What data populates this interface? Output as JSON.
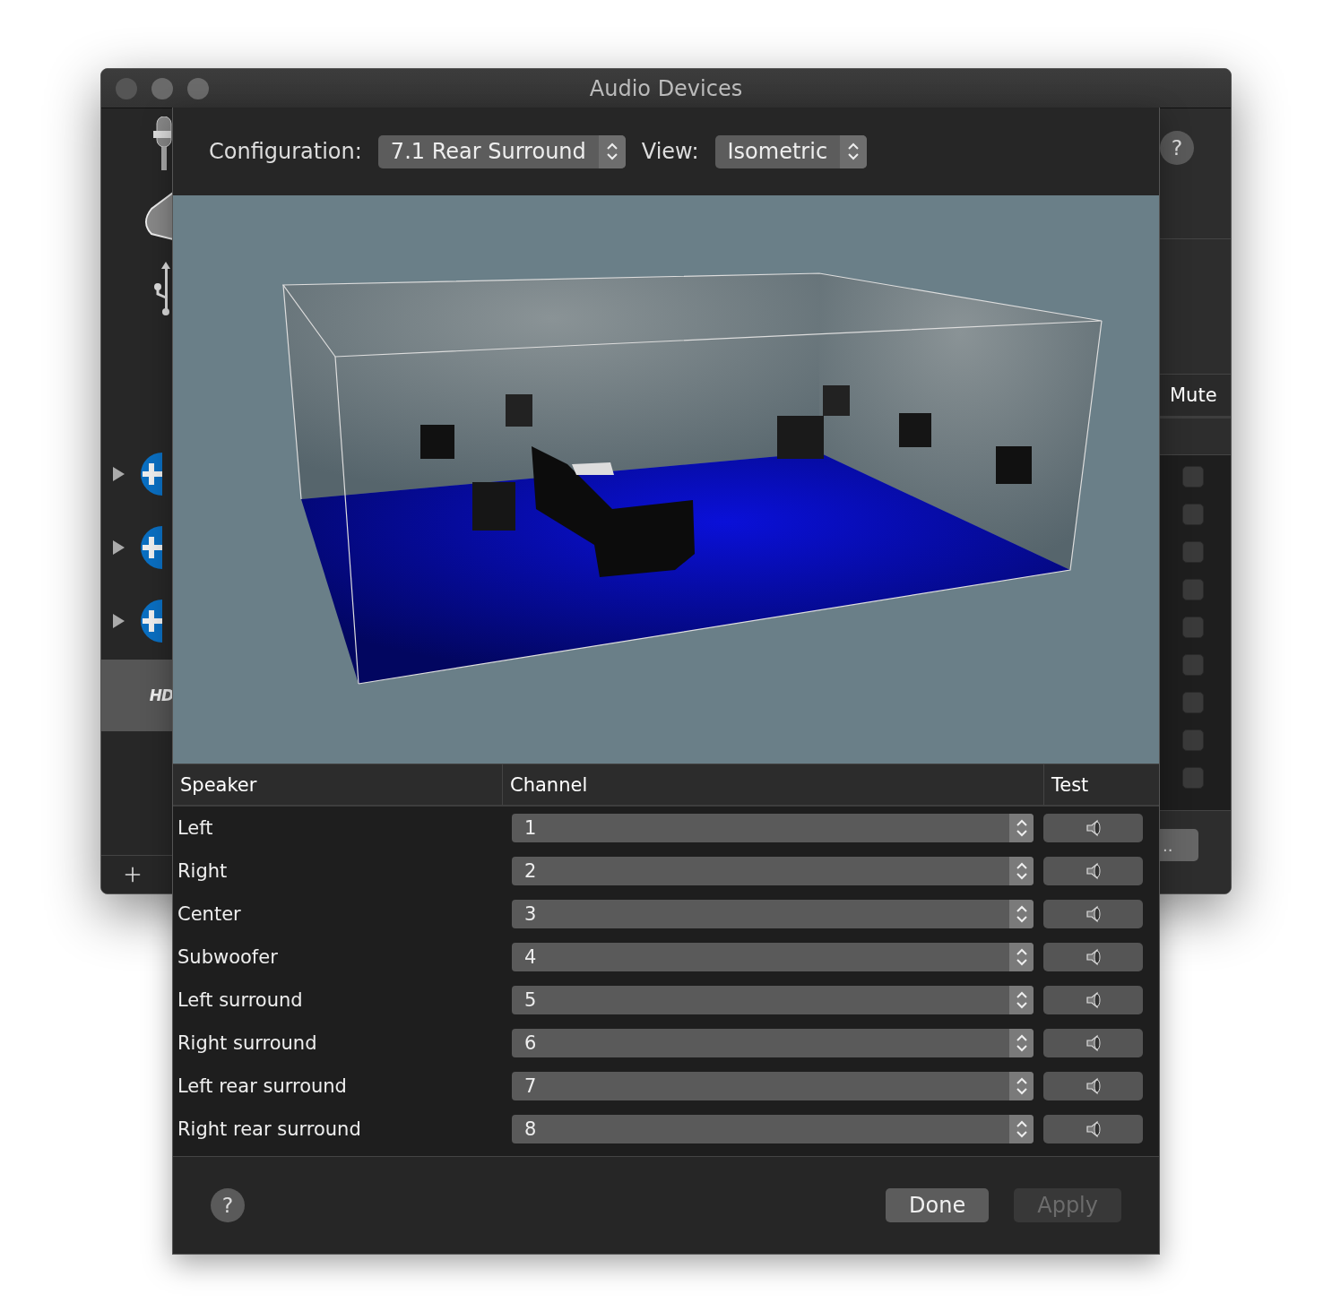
{
  "window": {
    "title": "Audio Devices"
  },
  "sidebar": {
    "devices": [
      {
        "kind": "microphone",
        "selected": false
      },
      {
        "kind": "speaker",
        "selected": false
      },
      {
        "kind": "usb",
        "selected": false
      },
      {
        "kind": "aggregate",
        "selected": false,
        "expanded": false
      },
      {
        "kind": "aggregate",
        "selected": false,
        "expanded": false
      },
      {
        "kind": "aggregate",
        "selected": false,
        "expanded": false
      },
      {
        "kind": "hd",
        "label": "HD",
        "selected": true
      }
    ]
  },
  "side_panel": {
    "help": "?",
    "mute_header": "Mute",
    "mutes": [
      {
        "checked": false
      },
      {
        "checked": false
      },
      {
        "checked": false
      },
      {
        "checked": false
      },
      {
        "checked": false
      },
      {
        "checked": false
      },
      {
        "checked": false
      },
      {
        "checked": false
      },
      {
        "checked": false
      }
    ],
    "button": ".."
  },
  "sheet": {
    "configuration": {
      "label": "Configuration:",
      "value": "7.1 Rear Surround"
    },
    "view": {
      "label": "View:",
      "value": "Isometric"
    },
    "table": {
      "columns": [
        "Speaker",
        "Channel",
        "Test"
      ],
      "rows": [
        {
          "speaker": "Left",
          "channel": "1"
        },
        {
          "speaker": "Right",
          "channel": "2"
        },
        {
          "speaker": "Center",
          "channel": "3"
        },
        {
          "speaker": "Subwoofer",
          "channel": "4"
        },
        {
          "speaker": "Left surround",
          "channel": "5"
        },
        {
          "speaker": "Right surround",
          "channel": "6"
        },
        {
          "speaker": "Left rear surround",
          "channel": "7"
        },
        {
          "speaker": "Right rear surround",
          "channel": "8"
        }
      ]
    },
    "help": "?",
    "buttons": [
      {
        "label": "Done",
        "disabled": false
      },
      {
        "label": "Apply",
        "disabled": true
      }
    ]
  }
}
